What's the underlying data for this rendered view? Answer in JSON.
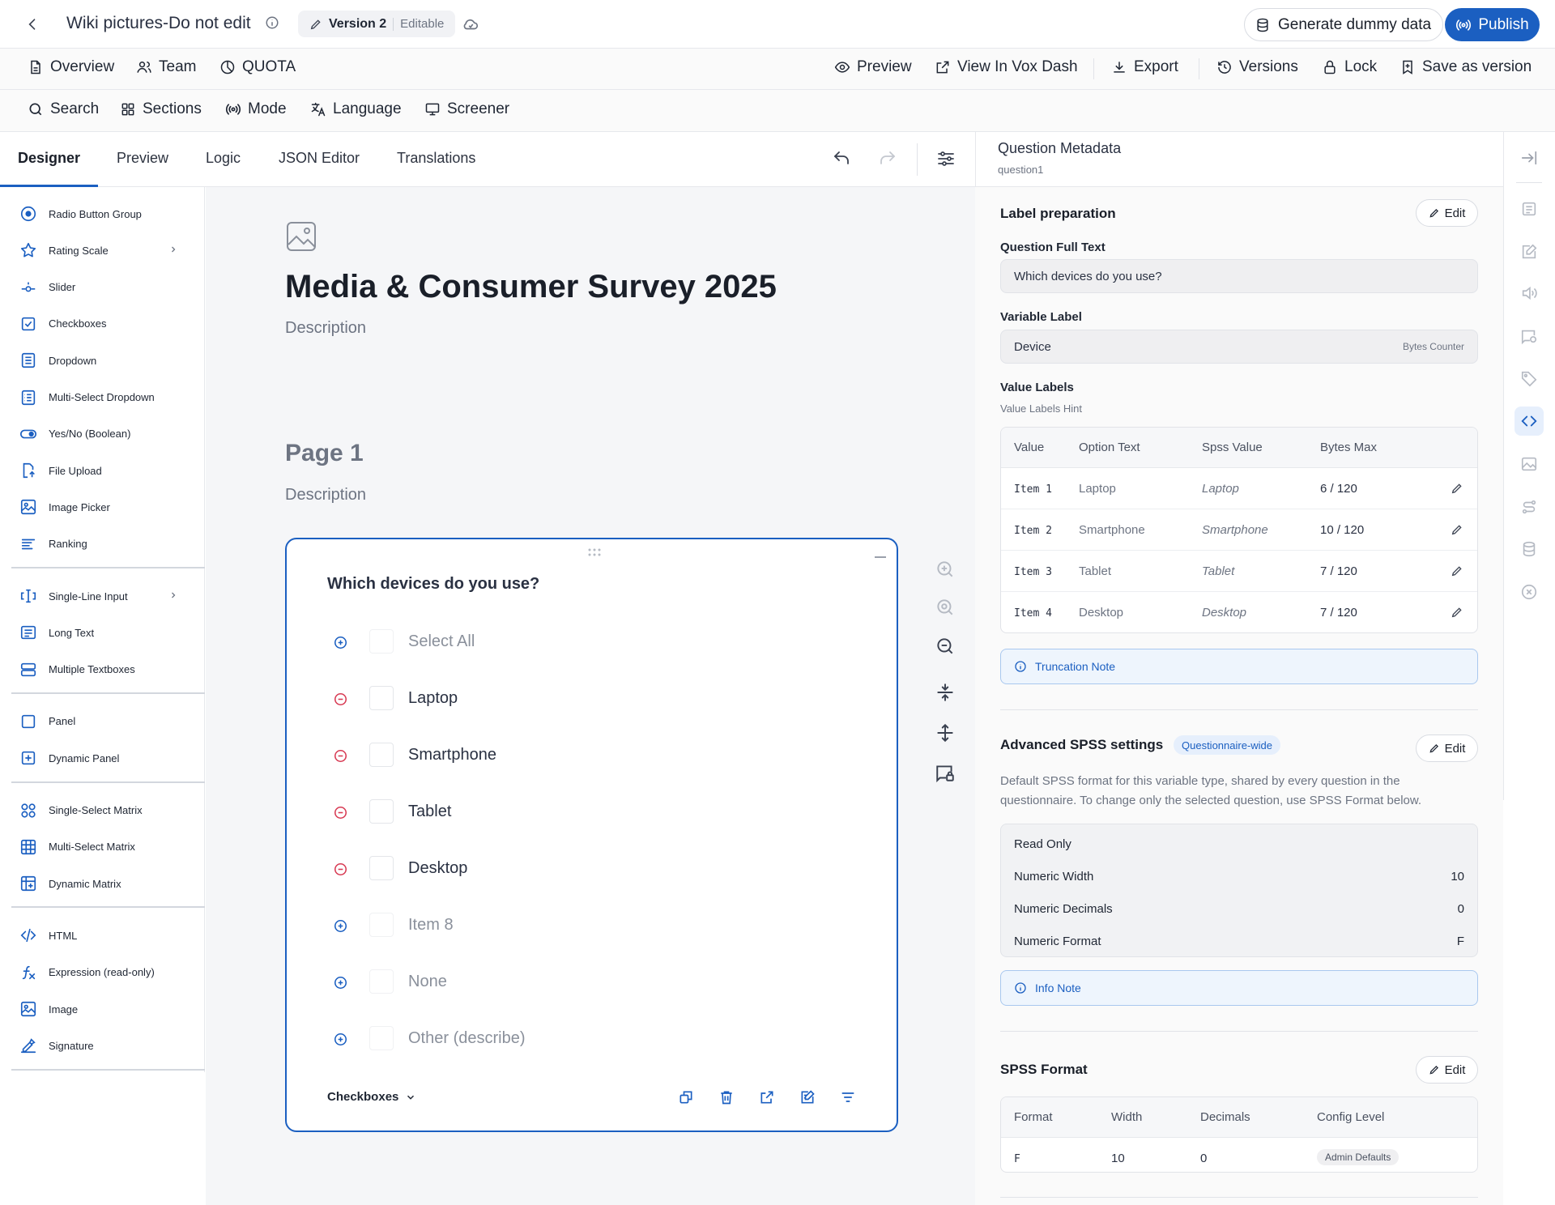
{
  "header": {
    "title": "Wiki pictures-Do not edit",
    "version_label": "Version 2",
    "version_state": "Editable",
    "generate_label": "Generate dummy data",
    "publish_label": "Publish"
  },
  "nav": {
    "left": [
      {
        "label": "Overview",
        "icon": "document-icon"
      },
      {
        "label": "Team",
        "icon": "users-icon"
      },
      {
        "label": "QUOTA",
        "icon": "pie-chart-icon"
      }
    ],
    "right": [
      {
        "label": "Preview",
        "icon": "eye-icon"
      },
      {
        "label": "View In Vox Dash",
        "icon": "external-link-icon"
      },
      {
        "label": "Export",
        "icon": "download-icon"
      },
      {
        "label": "Versions",
        "icon": "history-icon"
      },
      {
        "label": "Lock",
        "icon": "lock-icon"
      },
      {
        "label": "Save as version",
        "icon": "bookmark-icon"
      }
    ]
  },
  "toolbar": [
    {
      "label": "Search",
      "icon": "search-icon"
    },
    {
      "label": "Sections",
      "icon": "grid-icon"
    },
    {
      "label": "Mode",
      "icon": "broadcast-icon"
    },
    {
      "label": "Language",
      "icon": "translate-icon"
    },
    {
      "label": "Screener",
      "icon": "monitor-icon"
    }
  ],
  "tabs": [
    "Designer",
    "Preview",
    "Logic",
    "JSON Editor",
    "Translations"
  ],
  "sidebar": {
    "groups": [
      [
        {
          "label": "Radio Button Group",
          "icon": "radio-icon"
        },
        {
          "label": "Rating Scale",
          "icon": "star-icon",
          "submenu": true
        },
        {
          "label": "Slider",
          "icon": "slider-icon"
        },
        {
          "label": "Checkboxes",
          "icon": "checkbox-icon"
        },
        {
          "label": "Dropdown",
          "icon": "dropdown-icon"
        },
        {
          "label": "Multi-Select Dropdown",
          "icon": "multi-dropdown-icon"
        },
        {
          "label": "Yes/No (Boolean)",
          "icon": "toggle-icon"
        },
        {
          "label": "File Upload",
          "icon": "upload-icon"
        },
        {
          "label": "Image Picker",
          "icon": "image-picker-icon"
        },
        {
          "label": "Ranking",
          "icon": "ranking-icon"
        }
      ],
      [
        {
          "label": "Single-Line Input",
          "icon": "text-cursor-icon",
          "submenu": true
        },
        {
          "label": "Long Text",
          "icon": "long-text-icon"
        },
        {
          "label": "Multiple Textboxes",
          "icon": "textboxes-icon"
        }
      ],
      [
        {
          "label": "Panel",
          "icon": "panel-icon"
        },
        {
          "label": "Dynamic Panel",
          "icon": "dynamic-panel-icon"
        }
      ],
      [
        {
          "label": "Single-Select Matrix",
          "icon": "matrix-single-icon"
        },
        {
          "label": "Multi-Select Matrix",
          "icon": "matrix-multi-icon"
        },
        {
          "label": "Dynamic Matrix",
          "icon": "matrix-dynamic-icon"
        }
      ],
      [
        {
          "label": "HTML",
          "icon": "code-icon"
        },
        {
          "label": "Expression (read-only)",
          "icon": "function-icon"
        },
        {
          "label": "Image",
          "icon": "image-icon"
        },
        {
          "label": "Signature",
          "icon": "signature-icon"
        }
      ]
    ]
  },
  "survey": {
    "title": "Media & Consumer Survey 2025",
    "description": "Description",
    "page_title": "Page 1",
    "page_description": "Description",
    "question": {
      "text": "Which devices do you use?",
      "type_label": "Checkboxes",
      "options": [
        {
          "label": "Select All",
          "state": "add"
        },
        {
          "label": "Laptop",
          "state": "remove"
        },
        {
          "label": "Smartphone",
          "state": "remove"
        },
        {
          "label": "Tablet",
          "state": "remove"
        },
        {
          "label": "Desktop",
          "state": "remove"
        },
        {
          "label": "Item 8",
          "state": "add"
        },
        {
          "label": "None",
          "state": "add"
        },
        {
          "label": "Other (describe)",
          "state": "add"
        }
      ]
    }
  },
  "metadata": {
    "title": "Question Metadata",
    "subtitle": "question1",
    "label_prep": {
      "title": "Label preparation",
      "edit": "Edit",
      "full_text_label": "Question Full Text",
      "full_text_value": "Which devices do you use?",
      "var_label": "Variable Label",
      "var_value": "Device",
      "var_hint": "Bytes Counter",
      "value_labels_title": "Value Labels",
      "value_labels_hint": "Value Labels Hint",
      "columns": [
        "Value",
        "Option Text",
        "Spss Value",
        "Bytes Max"
      ],
      "rows": [
        {
          "value": "Item 1",
          "option": "Laptop",
          "spss": "Laptop",
          "bytes": "6 / 120"
        },
        {
          "value": "Item 2",
          "option": "Smartphone",
          "spss": "Smartphone",
          "bytes": "10 / 120"
        },
        {
          "value": "Item 3",
          "option": "Tablet",
          "spss": "Tablet",
          "bytes": "7 / 120"
        },
        {
          "value": "Item 4",
          "option": "Desktop",
          "spss": "Desktop",
          "bytes": "7 / 120"
        }
      ],
      "note": "Truncation Note"
    },
    "advanced": {
      "title": "Advanced SPSS settings",
      "badge": "Questionnaire-wide",
      "edit": "Edit",
      "description": "Default SPSS format for this variable type, shared by every question in the questionnaire. To change only the selected question, use SPSS Format below.",
      "read_only": "Read Only",
      "fields": [
        {
          "label": "Numeric Width",
          "value": "10"
        },
        {
          "label": "Numeric Decimals",
          "value": "0"
        },
        {
          "label": "Numeric Format",
          "value": "F"
        }
      ],
      "note": "Info Note"
    },
    "format": {
      "title": "SPSS Format",
      "edit": "Edit",
      "columns": [
        "Format",
        "Width",
        "Decimals",
        "Config Level"
      ],
      "row": {
        "format": "F",
        "width": "10",
        "decimals": "0",
        "level": "Admin Defaults"
      }
    }
  },
  "colors": {
    "accent": "#1b5fc1",
    "danger": "#d83b54"
  }
}
